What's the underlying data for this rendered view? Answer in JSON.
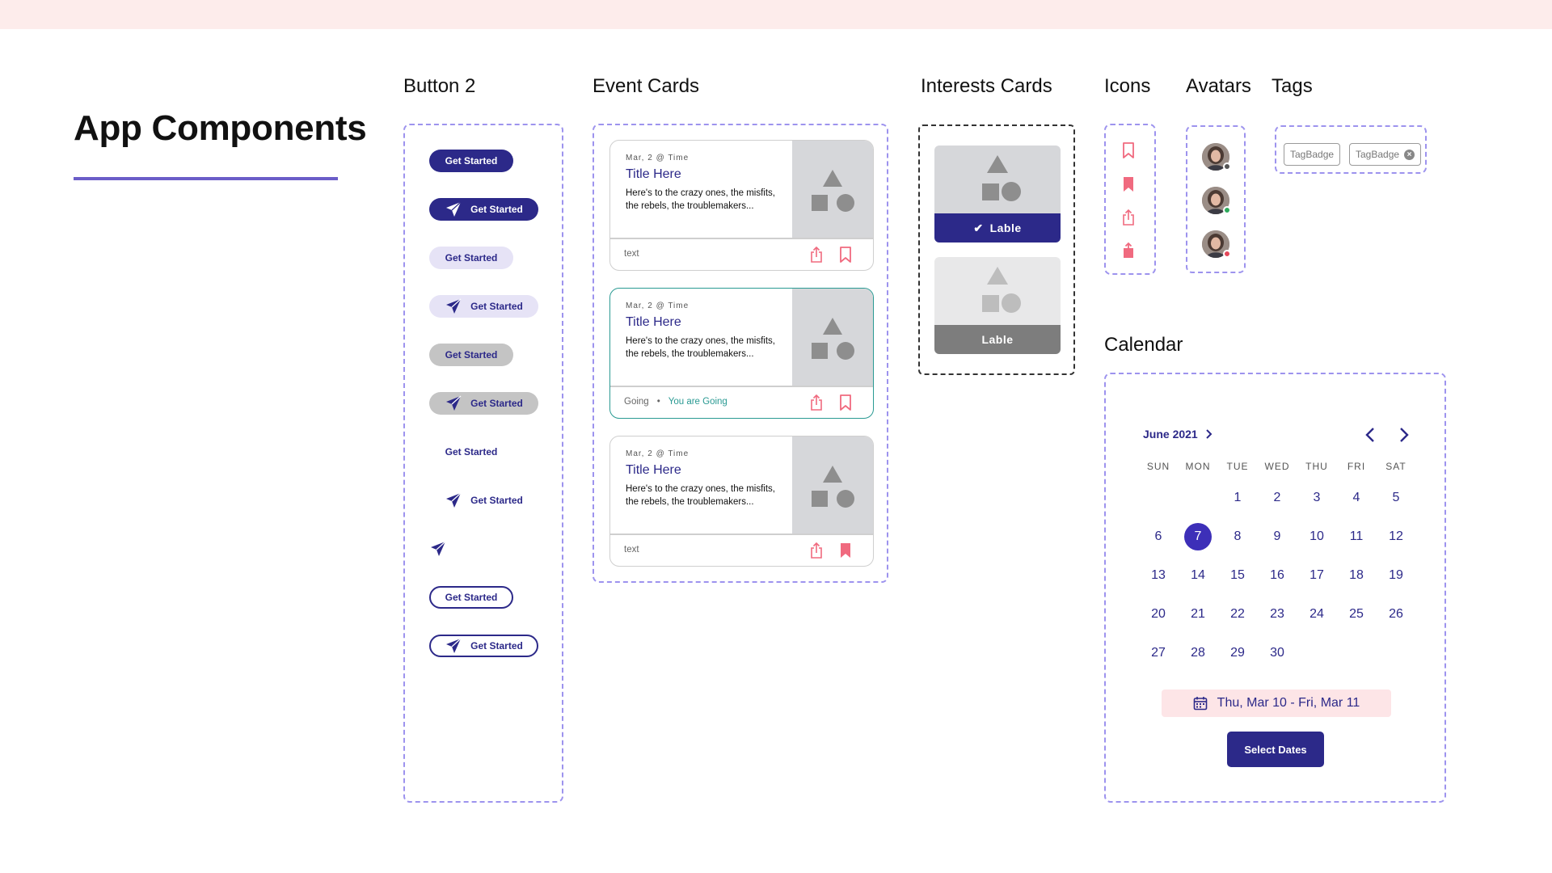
{
  "page": {
    "title": "App Components"
  },
  "sections": {
    "button2": "Button 2",
    "event_cards": "Event Cards",
    "interests_cards": "Interests Cards",
    "icons": "Icons",
    "avatars": "Avatars",
    "tags": "Tags",
    "calendar": "Calendar"
  },
  "buttons": [
    {
      "label": "Get Started",
      "style": "filled",
      "icon": ""
    },
    {
      "label": "Get Started",
      "style": "filled",
      "icon": "send-icon"
    },
    {
      "label": "Get Started",
      "style": "light",
      "icon": ""
    },
    {
      "label": "Get Started",
      "style": "light",
      "icon": "send-icon"
    },
    {
      "label": "Get Started",
      "style": "grey",
      "icon": ""
    },
    {
      "label": "Get Started",
      "style": "grey",
      "icon": "send-icon"
    },
    {
      "label": "Get Started",
      "style": "text",
      "icon": ""
    },
    {
      "label": "Get Started",
      "style": "text",
      "icon": "send-icon"
    },
    {
      "label": "",
      "style": "icon-only",
      "icon": "send-icon"
    },
    {
      "label": "Get Started",
      "style": "outline",
      "icon": ""
    },
    {
      "label": "Get Started",
      "style": "outline",
      "icon": "send-icon"
    }
  ],
  "event_cards": [
    {
      "date": "Mar, 2 @ Time",
      "title": "Title Here",
      "description": "Here's to the crazy ones, the misfits, the rebels, the troublemakers...",
      "footer": "text",
      "going": "",
      "bookmarked": false,
      "active": false
    },
    {
      "date": "Mar, 2 @ Time",
      "title": "Title Here",
      "description": "Here's to the crazy ones, the misfits, the rebels, the troublemakers...",
      "footer": "Going",
      "going": "You are Going",
      "bookmarked": false,
      "active": true
    },
    {
      "date": "Mar, 2 @ Time",
      "title": "Title Here",
      "description": "Here's to the crazy ones, the misfits, the rebels, the troublemakers...",
      "footer": "text",
      "going": "",
      "bookmarked": true,
      "active": false
    }
  ],
  "interests_cards": [
    {
      "label": "Lable",
      "selected": true
    },
    {
      "label": "Lable",
      "selected": false
    }
  ],
  "icons": [
    "bookmark-outline-icon",
    "bookmark-filled-icon",
    "share-outline-icon",
    "share-filled-icon"
  ],
  "avatars": [
    {
      "status": "offline",
      "status_color": "#555555"
    },
    {
      "status": "online",
      "status_color": "#2eaa5c"
    },
    {
      "status": "busy",
      "status_color": "#e4485a"
    }
  ],
  "tags": [
    {
      "label": "TagBadge",
      "removable": false
    },
    {
      "label": "TagBadge",
      "removable": true
    }
  ],
  "calendar": {
    "month": "June 2021",
    "weekdays": [
      "SUN",
      "MON",
      "TUE",
      "WED",
      "THU",
      "FRI",
      "SAT"
    ],
    "days": [
      [
        "",
        "",
        "1",
        "2",
        "3",
        "4",
        "5"
      ],
      [
        "6",
        "7",
        "8",
        "9",
        "10",
        "11",
        "12"
      ],
      [
        "13",
        "14",
        "15",
        "16",
        "17",
        "18",
        "19"
      ],
      [
        "20",
        "21",
        "22",
        "23",
        "24",
        "25",
        "26"
      ],
      [
        "27",
        "28",
        "29",
        "30",
        "",
        "",
        ""
      ]
    ],
    "selected_day": "7",
    "range": "Thu, Mar 10 - Fri, Mar 11",
    "select_button": "Select Dates"
  },
  "colors": {
    "primary": "#2c2989",
    "accent_line": "#6b5dc8",
    "dashed_border": "#9d93ee",
    "pink": "#f06a7f",
    "teal": "#2a9a93",
    "top_band": "#fdeceb"
  }
}
